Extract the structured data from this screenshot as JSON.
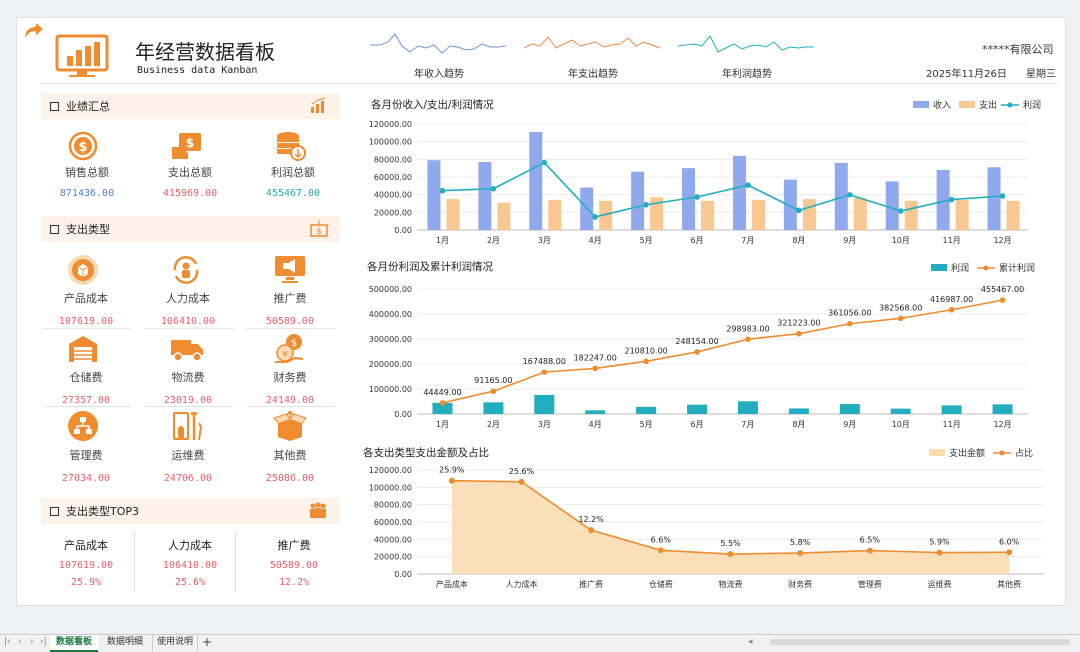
{
  "header": {
    "title": "年经营数据看板",
    "subtitle": "Business data Kanban",
    "company": "*****有限公司",
    "date": "2025年11月26日",
    "weekday": "星期三",
    "sparklines": [
      {
        "label": "年收入趋势",
        "color": "#6f95d6"
      },
      {
        "label": "年支出趋势",
        "color": "#f0884a"
      },
      {
        "label": "年利润趋势",
        "color": "#22aebf"
      }
    ]
  },
  "summary": {
    "title": "业绩汇总",
    "items": [
      {
        "label": "销售总额",
        "value": "871436.00",
        "color": "#4f7fd1",
        "icon": "dollar-coin-icon"
      },
      {
        "label": "支出总额",
        "value": "415969.00",
        "color": "#e4606d",
        "icon": "money-bill-icon"
      },
      {
        "label": "利润总额",
        "value": "455467.00",
        "color": "#20a9b6",
        "icon": "coin-stack-icon"
      }
    ]
  },
  "expense_types": {
    "title": "支出类型",
    "items": [
      {
        "label": "产品成本",
        "value": "107619.00",
        "icon": "box-icon"
      },
      {
        "label": "人力成本",
        "value": "106410.00",
        "icon": "people-cycle-icon"
      },
      {
        "label": "推广费",
        "value": "50589.00",
        "icon": "megaphone-icon"
      },
      {
        "label": "仓储费",
        "value": "27357.00",
        "icon": "warehouse-icon"
      },
      {
        "label": "物流费",
        "value": "23019.00",
        "icon": "truck-icon"
      },
      {
        "label": "财务费",
        "value": "24149.00",
        "icon": "finance-coins-icon"
      },
      {
        "label": "管理费",
        "value": "27034.00",
        "icon": "org-chart-icon"
      },
      {
        "label": "运维费",
        "value": "24706.00",
        "icon": "tools-icon"
      },
      {
        "label": "其他费",
        "value": "25086.00",
        "icon": "open-box-icon"
      }
    ]
  },
  "top3": {
    "title": "支出类型TOP3",
    "items": [
      {
        "label": "产品成本",
        "value": "107619.00",
        "pct": "25.9%"
      },
      {
        "label": "人力成本",
        "value": "106410.00",
        "pct": "25.6%"
      },
      {
        "label": "推广费",
        "value": "50589.00",
        "pct": "12.2%"
      }
    ]
  },
  "sheet_tabs": [
    "数据看板",
    "数据明细",
    "使用说明"
  ],
  "colors": {
    "income": "#8fa9ec",
    "expense": "#f9c892",
    "profit": "#22aebf",
    "cumulative": "#f08c30",
    "accent": "#f08c30"
  },
  "chart_data": [
    {
      "type": "bar",
      "title": "各月份收入/支出/利润情况",
      "categories": [
        "1月",
        "2月",
        "3月",
        "4月",
        "5月",
        "6月",
        "7月",
        "8月",
        "9月",
        "10月",
        "11月",
        "12月"
      ],
      "series": [
        {
          "name": "收入",
          "type": "bar",
          "values": [
            79000,
            77000,
            111000,
            48000,
            66000,
            70000,
            84000,
            57000,
            76000,
            55000,
            68000,
            71000
          ]
        },
        {
          "name": "支出",
          "type": "bar",
          "values": [
            35000,
            31000,
            34000,
            33000,
            37000,
            33000,
            34000,
            35000,
            36000,
            33000,
            34000,
            33000
          ]
        },
        {
          "name": "利润",
          "type": "line",
          "values": [
            44449,
            46716,
            76323,
            14759,
            28563,
            37344,
            50829,
            22240,
            39833,
            21512,
            34419,
            38480
          ]
        }
      ],
      "ylim": [
        0,
        120000
      ],
      "yticks": [
        "0.00",
        "20000.00",
        "40000.00",
        "60000.00",
        "80000.00",
        "100000.00",
        "120000.00"
      ],
      "legend": "top-right"
    },
    {
      "type": "bar",
      "title": "各月份利润及累计利润情况",
      "categories": [
        "1月",
        "2月",
        "3月",
        "4月",
        "5月",
        "6月",
        "7月",
        "8月",
        "9月",
        "10月",
        "11月",
        "12月"
      ],
      "series": [
        {
          "name": "利润",
          "type": "bar",
          "values": [
            44449,
            46716,
            76323,
            14759,
            28563,
            37344,
            50829,
            22240,
            39833,
            21512,
            34419,
            38480
          ]
        },
        {
          "name": "累计利润",
          "type": "line",
          "values": [
            44449,
            91165,
            167488,
            182247,
            210810,
            248154,
            298983,
            321223,
            361056,
            382568,
            416987,
            455467
          ],
          "labels": [
            "44449.00",
            "91165.00",
            "167488.00",
            "182247.00",
            "210810.00",
            "248154.00",
            "298983.00",
            "321223.00",
            "361056.00",
            "382568.00",
            "416987.00",
            "455467.00"
          ]
        }
      ],
      "ylim": [
        0,
        500000
      ],
      "yticks": [
        "0.00",
        "100000.00",
        "200000.00",
        "300000.00",
        "400000.00",
        "500000.00"
      ],
      "legend": "top-right"
    },
    {
      "type": "area",
      "title": "各支出类型支出金额及占比",
      "categories": [
        "产品成本",
        "人力成本",
        "推广费",
        "仓储费",
        "物流费",
        "财务费",
        "管理费",
        "运维费",
        "其他费"
      ],
      "series": [
        {
          "name": "支出金额",
          "type": "area",
          "values": [
            107619,
            106410,
            50589,
            27357,
            23019,
            24149,
            27034,
            24706,
            25086
          ]
        },
        {
          "name": "占比",
          "type": "line",
          "values": [
            25.9,
            25.6,
            12.2,
            6.6,
            5.5,
            5.8,
            6.5,
            5.9,
            6.0
          ],
          "labels": [
            "25.9%",
            "25.6%",
            "12.2%",
            "6.6%",
            "5.5%",
            "5.8%",
            "6.5%",
            "5.9%",
            "6.0%"
          ]
        }
      ],
      "ylim": [
        0,
        120000
      ],
      "yticks": [
        "0.00",
        "20000.00",
        "40000.00",
        "60000.00",
        "80000.00",
        "100000.00",
        "120000.00"
      ],
      "legend": "top-right"
    }
  ]
}
